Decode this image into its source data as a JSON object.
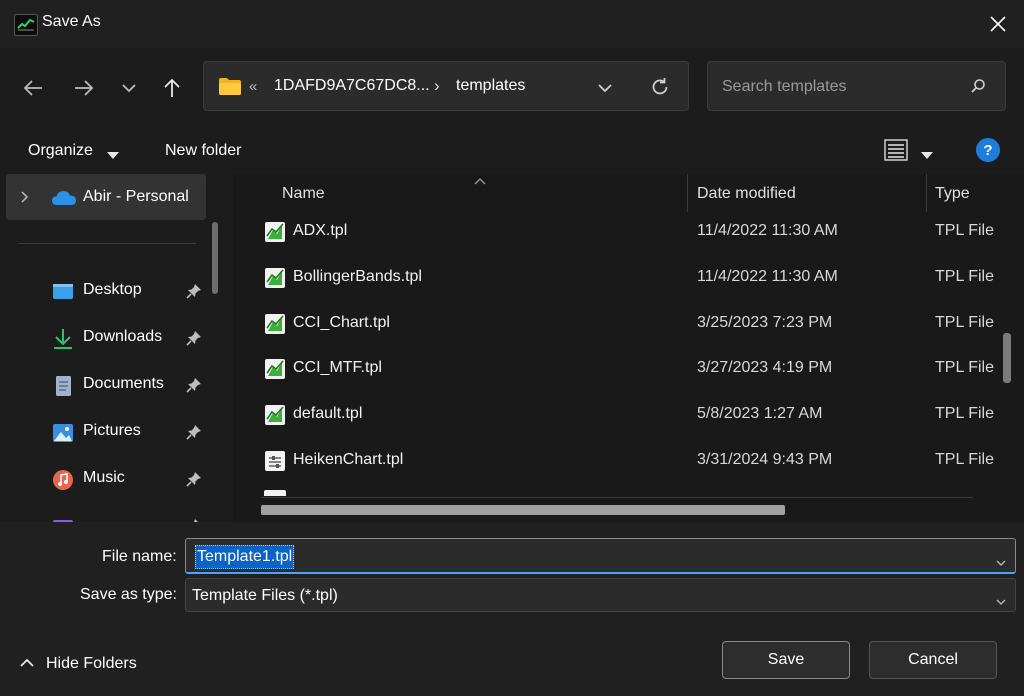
{
  "window": {
    "title": "Save As"
  },
  "address": {
    "overflow": "«",
    "segments": [
      "1DAFD9A7C67DC8...",
      "templates"
    ],
    "separator": "›"
  },
  "search": {
    "placeholder": "Search templates"
  },
  "toolbar": {
    "organize": "Organize",
    "new_folder": "New folder",
    "help": "?"
  },
  "sidebar": {
    "root": {
      "label": "Abir - Personal",
      "icon": "cloud-icon"
    },
    "items": [
      {
        "label": "Desktop",
        "icon": "desktop-icon",
        "color": "#3aa0e8"
      },
      {
        "label": "Downloads",
        "icon": "download-icon",
        "color": "#29c26b"
      },
      {
        "label": "Documents",
        "icon": "document-icon",
        "color": "#9fb3cf"
      },
      {
        "label": "Pictures",
        "icon": "pictures-icon",
        "color": "#3b8fe0"
      },
      {
        "label": "Music",
        "icon": "music-icon",
        "color": "#e8664a"
      }
    ]
  },
  "columns": {
    "name": "Name",
    "date": "Date modified",
    "type": "Type"
  },
  "files": [
    {
      "name": "ADX.tpl",
      "date": "11/4/2022 11:30 AM",
      "type": "TPL File",
      "icon": "chart-template-icon"
    },
    {
      "name": "BollingerBands.tpl",
      "date": "11/4/2022 11:30 AM",
      "type": "TPL File",
      "icon": "chart-template-icon"
    },
    {
      "name": "CCI_Chart.tpl",
      "date": "3/25/2023 7:23 PM",
      "type": "TPL File",
      "icon": "chart-template-icon"
    },
    {
      "name": "CCI_MTF.tpl",
      "date": "3/27/2023 4:19 PM",
      "type": "TPL File",
      "icon": "chart-template-icon"
    },
    {
      "name": "default.tpl",
      "date": "5/8/2023 1:27 AM",
      "type": "TPL File",
      "icon": "chart-template-icon"
    },
    {
      "name": "HeikenChart.tpl",
      "date": "3/31/2024 9:43 PM",
      "type": "TPL File",
      "icon": "generic-file-icon"
    }
  ],
  "form": {
    "file_name_label": "File name:",
    "file_name_value": "Template1.tpl",
    "save_type_label": "Save as type:",
    "save_type_value": "Template Files (*.tpl)"
  },
  "footer": {
    "hide_folders": "Hide Folders",
    "save": "Save",
    "cancel": "Cancel"
  },
  "colors": {
    "accent": "#0a64c8",
    "help": "#1e7ddb",
    "folder": "#f0b429"
  }
}
